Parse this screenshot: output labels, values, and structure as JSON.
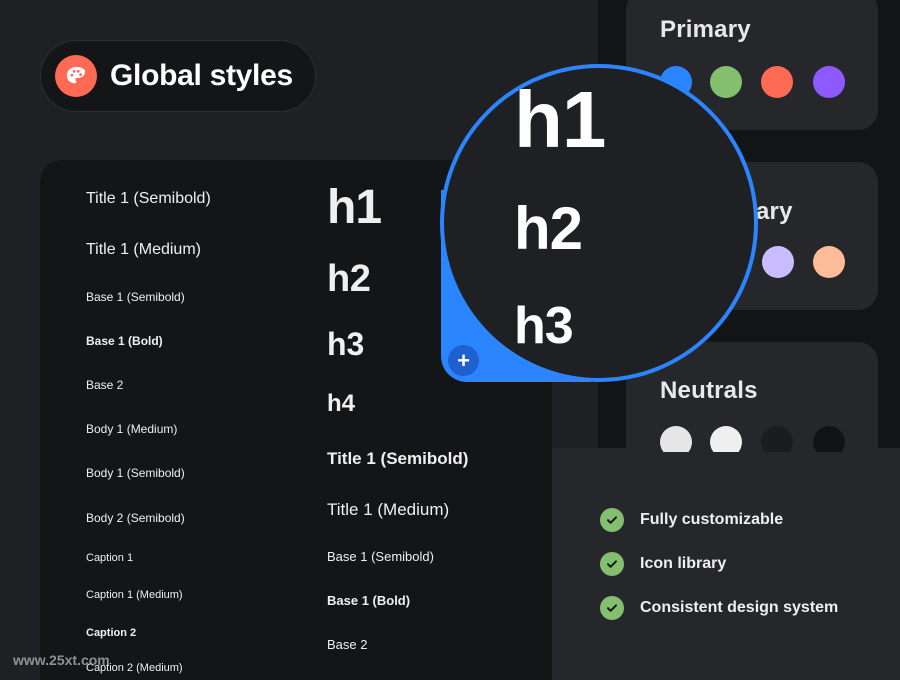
{
  "header": {
    "title": "Global styles",
    "icon": "palette-icon",
    "icon_color": "#ff6a55"
  },
  "left_column": [
    "Title 1 (Semibold)",
    "Title 1 (Medium)",
    "Base 1 (Semibold)",
    "Base 1 (Bold)",
    "Base 2",
    "Body 1 (Medium)",
    "Body 1 (Semibold)",
    "Body 2 (Semibold)",
    "Caption 1",
    "Caption 1 (Medium)",
    "Caption 2",
    "Caption 2 (Medium)"
  ],
  "right_column": [
    "h1",
    "h2",
    "h3",
    "h4",
    "Title 1 (Semibold)",
    "Title 1 (Medium)",
    "Base 1 (Semibold)",
    "Base 1 (Bold)",
    "Base 2"
  ],
  "magnifier": {
    "items": [
      "h1",
      "h2",
      "h3"
    ],
    "ring_color": "#2a85ff",
    "add_icon": "plus-icon",
    "add_label": "+"
  },
  "colors": {
    "primary": {
      "title": "Primary",
      "swatches": [
        "#2a85ff",
        "#83bf6e",
        "#ff6a55",
        "#8e59ff"
      ]
    },
    "secondary": {
      "title": "Secondary",
      "visible_title": "ary",
      "swatches": [
        "#cabdff",
        "#ffbc99"
      ]
    },
    "neutrals": {
      "title": "Neutrals",
      "swatches": [
        "#e6e6e6",
        "#efefef",
        "#1a1d1f",
        "#111315"
      ]
    }
  },
  "features": [
    "Fully customizable",
    "Icon library",
    "Consistent design system"
  ],
  "check_color": "#83bf6e",
  "watermark": "www.25xt.com"
}
